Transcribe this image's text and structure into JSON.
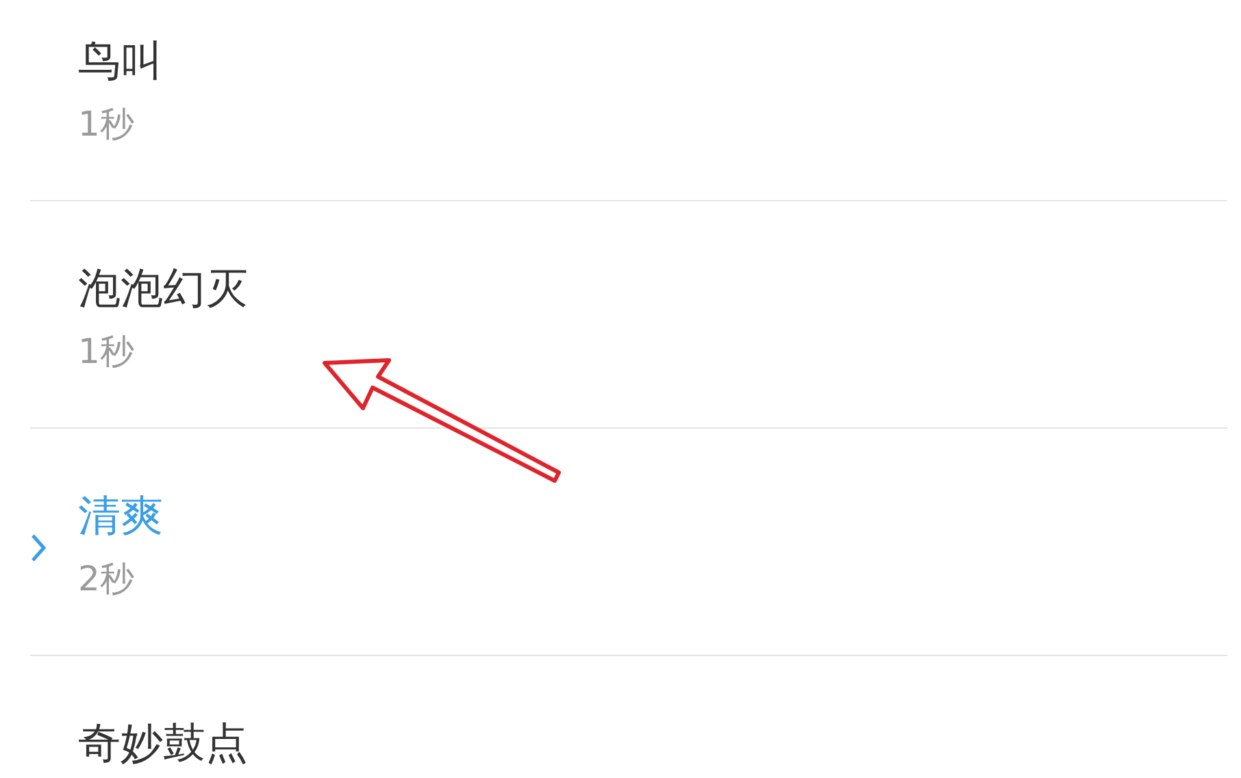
{
  "sounds": [
    {
      "name": "鸟叫",
      "duration": "1秒",
      "selected": false
    },
    {
      "name": "泡泡幻灭",
      "duration": "1秒",
      "selected": false
    },
    {
      "name": "清爽",
      "duration": "2秒",
      "selected": true
    },
    {
      "name": "奇妙鼓点",
      "selected": false
    }
  ]
}
